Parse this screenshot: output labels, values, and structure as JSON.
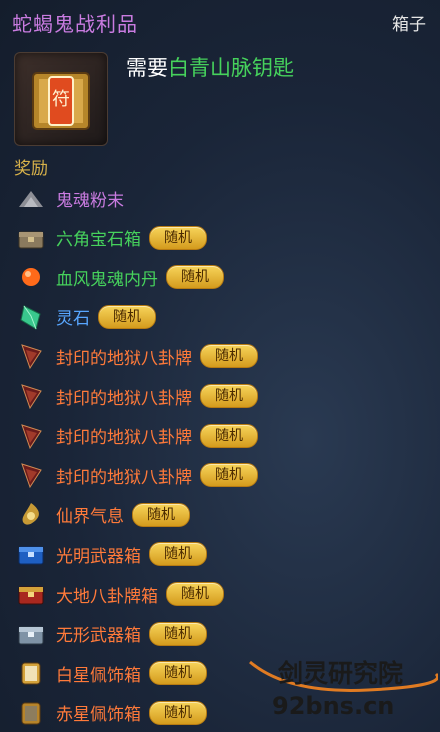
{
  "header": {
    "title": "蛇蝎鬼战利品",
    "type": "箱子"
  },
  "requirement": {
    "prefix": "需要",
    "key_name": "白青山脉钥匙",
    "key_icon": "key-box-icon"
  },
  "rewards_label": "奖励",
  "random_label": "随机",
  "items": [
    {
      "name": "鬼魂粉末",
      "color": "purple",
      "icon": "powder-pile-icon",
      "random": false
    },
    {
      "name": "六角宝石箱",
      "color": "green",
      "icon": "gem-chest-icon",
      "random": true
    },
    {
      "name": "血风鬼魂内丹",
      "color": "green",
      "icon": "orange-orb-icon",
      "random": true
    },
    {
      "name": "灵石",
      "color": "blue",
      "icon": "green-crystal-icon",
      "random": true
    },
    {
      "name": "封印的地狱八卦牌",
      "color": "orange",
      "icon": "bagua-tablet-icon",
      "random": true
    },
    {
      "name": "封印的地狱八卦牌",
      "color": "orange",
      "icon": "bagua-tablet-icon",
      "random": true
    },
    {
      "name": "封印的地狱八卦牌",
      "color": "orange",
      "icon": "bagua-tablet-icon",
      "random": true
    },
    {
      "name": "封印的地狱八卦牌",
      "color": "orange",
      "icon": "bagua-tablet-icon",
      "random": true
    },
    {
      "name": "仙界气息",
      "color": "orange",
      "icon": "golden-essence-icon",
      "random": true
    },
    {
      "name": "光明武器箱",
      "color": "orange",
      "icon": "blue-chest-icon",
      "random": true
    },
    {
      "name": "大地八卦牌箱",
      "color": "orange",
      "icon": "red-gold-chest-icon",
      "random": true
    },
    {
      "name": "无形武器箱",
      "color": "orange",
      "icon": "silver-chest-icon",
      "random": true
    },
    {
      "name": "白星佩饰箱",
      "color": "orange",
      "icon": "white-star-chest-icon",
      "random": true
    },
    {
      "name": "赤星佩饰箱",
      "color": "orange",
      "icon": "red-star-chest-icon",
      "random": true
    }
  ],
  "watermark": {
    "line1": "剑灵研究院",
    "line2": "92bns.cn"
  }
}
